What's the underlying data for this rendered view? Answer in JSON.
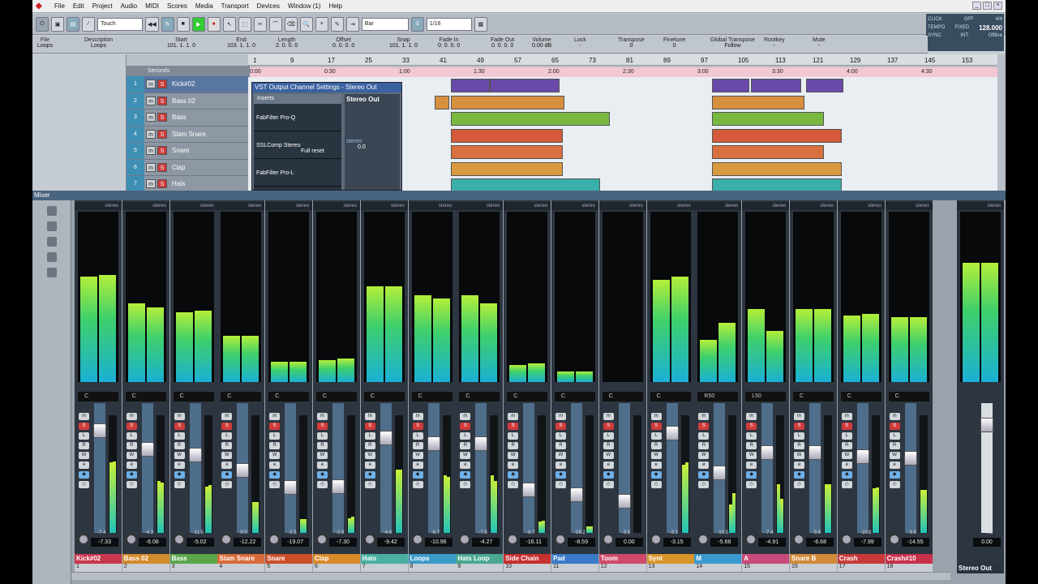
{
  "menu": {
    "items": [
      "File",
      "Edit",
      "Project",
      "Audio",
      "MIDI",
      "Scores",
      "Media",
      "Transport",
      "Devices",
      "Window (1)",
      "Help"
    ]
  },
  "toolbar": {
    "automation_mode": "Touch",
    "grid": "Bar",
    "quantize": "1/16"
  },
  "transport": {
    "click": "CLICK",
    "click_val": "OFF",
    "tempo_lbl": "TEMPO",
    "tempo_mode": "FIXED",
    "sig": "4/4",
    "tempo": "128.000",
    "sync": "SYNC",
    "int": "INT.",
    "offline": "Offline"
  },
  "infoline": {
    "labels": [
      "File",
      "Description",
      "Start",
      "End",
      "Length",
      "Offset",
      "Snap",
      "Fade In",
      "Fade Out",
      "Volume",
      "Lock",
      "Transpose",
      "Finetune",
      "Global Transpose",
      "Rootkey",
      "Mute"
    ],
    "values": [
      "Loops",
      "Loops",
      "101. 1. 1.  0",
      "103. 1. 1.  0",
      "2. 0. 0.  0",
      "0. 0. 0.  0",
      "101. 1. 1.  0",
      "0. 0. 0.  0",
      "0. 0. 0.  0",
      "0.00 dB",
      "-",
      "0",
      "0",
      "Follow",
      "-",
      "-"
    ]
  },
  "tracks_header": "Seconds",
  "tracks": [
    {
      "num": "1",
      "name": "Kick#02"
    },
    {
      "num": "2",
      "name": "Bass 02"
    },
    {
      "num": "3",
      "name": "Bass"
    },
    {
      "num": "4",
      "name": "Slam Snare"
    },
    {
      "num": "5",
      "name": "Snare"
    },
    {
      "num": "6",
      "name": "Clap"
    },
    {
      "num": "7",
      "name": "Hats"
    }
  ],
  "ruler_bars": [
    "1",
    "9",
    "17",
    "25",
    "33",
    "41",
    "49",
    "57",
    "65",
    "73",
    "81",
    "89",
    "97",
    "105",
    "113",
    "121",
    "129",
    "137",
    "145",
    "153"
  ],
  "ruler_time": [
    "0:00",
    "0:30",
    "1:00",
    "1:30",
    "2:00",
    "2:30",
    "3:00",
    "3:30",
    "4:00",
    "4:30"
  ],
  "vst": {
    "title": "VST Output Channel Settings - Stereo Out",
    "inserts": "Inserts",
    "slot1": "FabFilter Pro-Q",
    "slot2": "SSLComp Stereo",
    "slot2_preset": "Full reset",
    "slot3": "FabFilter Pro-L",
    "output": "Stereo Out",
    "stereo_lbl": "stereo",
    "gain": "0.0"
  },
  "mixer": {
    "title": "Mixer",
    "stereo_label": "stereo",
    "channels": [
      {
        "name": "Kick#02",
        "num": "1",
        "pan": "C",
        "db": "-7.33",
        "peak": "-7.4",
        "color": "#c9374e",
        "lvl": [
          0.62,
          0.63
        ]
      },
      {
        "name": "Bass 02",
        "num": "2",
        "pan": "C",
        "db": "-6.08",
        "peak": "-4.3",
        "color": "#d38a2a",
        "lvl": [
          0.46,
          0.44
        ]
      },
      {
        "name": "Bass",
        "num": "3",
        "pan": "C",
        "db": "-5.02",
        "peak": "-11.5",
        "color": "#5aa64a",
        "lvl": [
          0.41,
          0.42
        ]
      },
      {
        "name": "Slam Snare",
        "num": "4",
        "pan": "C",
        "db": "-12.22",
        "peak": "0.0",
        "color": "#d96a3a",
        "lvl": [
          0.27,
          0.27
        ]
      },
      {
        "name": "Snare",
        "num": "5",
        "pan": "C",
        "db": "-19.07",
        "peak": "-2.5",
        "color": "#cc4f2a",
        "lvl": [
          0.12,
          0.12
        ]
      },
      {
        "name": "Clap",
        "num": "6",
        "pan": "C",
        "db": "-7.30",
        "peak": "-2.6",
        "color": "#d98a2a",
        "lvl": [
          0.13,
          0.14
        ]
      },
      {
        "name": "Hats",
        "num": "7",
        "pan": "C",
        "db": "-9.42",
        "peak": "-4.6",
        "color": "#4ab0a0",
        "lvl": [
          0.56,
          0.56
        ]
      },
      {
        "name": "Loops",
        "num": "8",
        "pan": "C",
        "db": "-10.96",
        "peak": "-8.7",
        "color": "#3a9ac8",
        "lvl": [
          0.51,
          0.49
        ]
      },
      {
        "name": "Hats Loop",
        "num": "9",
        "pan": "C",
        "db": "-4.27",
        "peak": "-7.9",
        "color": "#4aa890",
        "lvl": [
          0.51,
          0.46
        ]
      },
      {
        "name": "Side Chain",
        "num": "10",
        "pan": "C",
        "db": "-16.11",
        "peak": "-6.7",
        "color": "#c83030",
        "lvl": [
          0.1,
          0.11
        ]
      },
      {
        "name": "Pad",
        "num": "11",
        "pan": "C",
        "db": "-8.59",
        "peak": "-18.2",
        "color": "#3a7ac8",
        "lvl": [
          0.06,
          0.06
        ]
      },
      {
        "name": "Toom",
        "num": "12",
        "pan": "C",
        "db": "0.00",
        "peak": "-3.5",
        "color": "#d04a6a",
        "lvl": [
          0.0,
          0.0
        ]
      },
      {
        "name": "Synt",
        "num": "13",
        "pan": "C",
        "db": "-3.15",
        "peak": "-3.2",
        "color": "#d8962a",
        "lvl": [
          0.6,
          0.62
        ]
      },
      {
        "name": "M",
        "num": "14",
        "pan": "R50",
        "db": "-5.68",
        "peak": "-10.5",
        "color": "#3a9ad0",
        "lvl": [
          0.25,
          0.35
        ]
      },
      {
        "name": "A",
        "num": "15",
        "pan": "L50",
        "db": "-4.91",
        "peak": "-7.4",
        "color": "#c84a7a",
        "lvl": [
          0.43,
          0.3
        ]
      },
      {
        "name": "Snare B",
        "num": "16",
        "pan": "C",
        "db": "-6.68",
        "peak": "-5.6",
        "color": "#d28a3a",
        "lvl": [
          0.43,
          0.43
        ]
      },
      {
        "name": "Crash",
        "num": "17",
        "pan": "C",
        "db": "-7.99",
        "peak": "-10.8",
        "color": "#c83a3a",
        "lvl": [
          0.39,
          0.4
        ]
      },
      {
        "name": "Crash#10",
        "num": "18",
        "pan": "C",
        "db": "-14.55",
        "peak": "-3.6",
        "color": "#c8304a",
        "lvl": [
          0.38,
          0.38
        ]
      }
    ],
    "master": {
      "name": "Stereo Out",
      "db": "0.00",
      "peak": "-0.3",
      "lvl": [
        0.7,
        0.7
      ]
    }
  }
}
